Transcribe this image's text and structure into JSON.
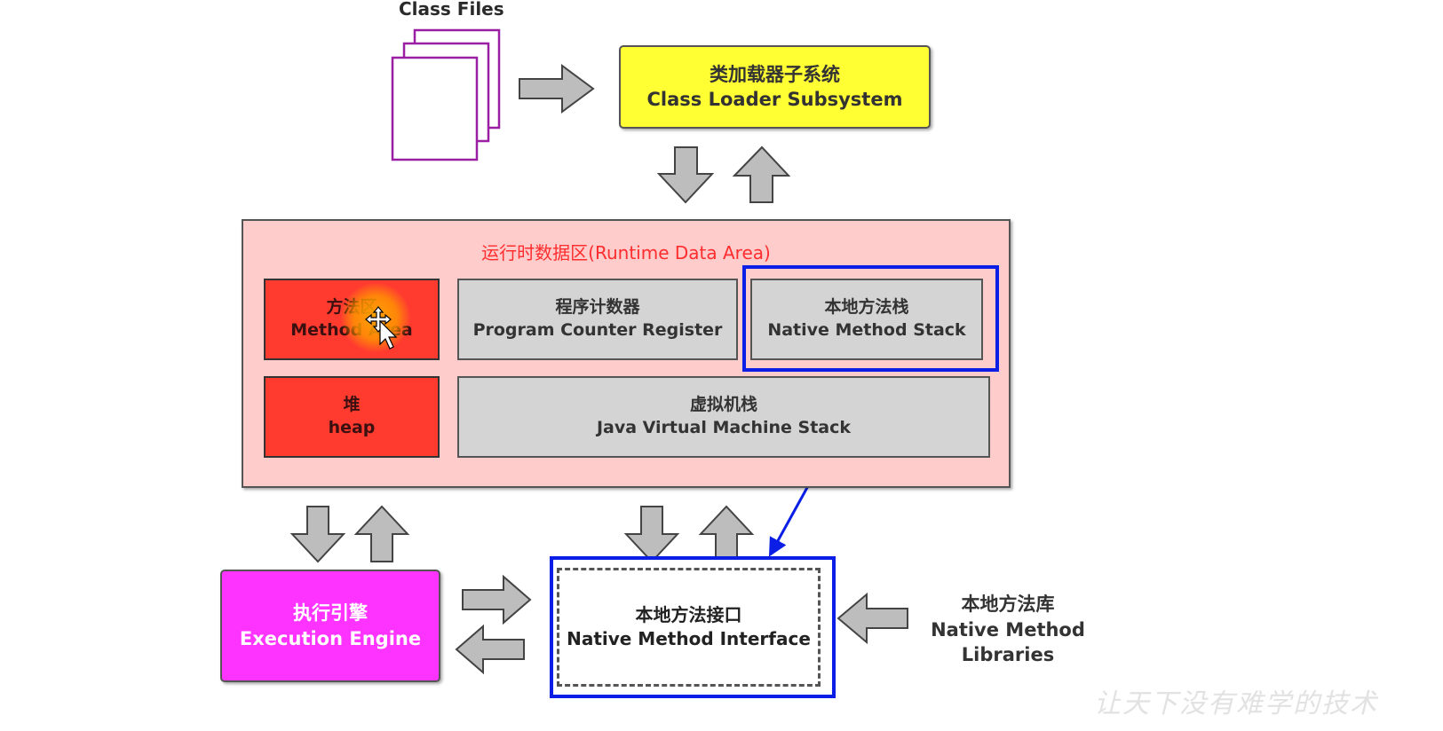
{
  "class_files": {
    "label": "Class Files"
  },
  "class_loader": {
    "line1": "类加载器子系统",
    "line2": "Class Loader Subsystem"
  },
  "runtime_area": {
    "title": "运行时数据区(Runtime Data Area)",
    "method_area": {
      "line1": "方法区",
      "line2": "Method Area"
    },
    "program_counter": {
      "line1": "程序计数器",
      "line2": "Program Counter Register"
    },
    "native_stack": {
      "line1": "本地方法栈",
      "line2": "Native Method Stack"
    },
    "heap": {
      "line1": "堆",
      "line2": "heap"
    },
    "jvm_stack": {
      "line1": "虚拟机栈",
      "line2": "Java Virtual Machine Stack"
    }
  },
  "execution_engine": {
    "line1": "执行引擎",
    "line2": "Execution Engine"
  },
  "native_interface": {
    "line1": "本地方法接口",
    "line2": "Native Method Interface"
  },
  "native_libraries": {
    "line1": "本地方法库",
    "line2": "Native Method",
    "line3": "Libraries"
  },
  "watermark": "让天下没有难学的技术",
  "colors": {
    "class_loader": "#ffff33",
    "runtime_area": "#ffcccc",
    "runtime_title": "#ff2d2d",
    "red_region": "#ff3b30",
    "gray_region": "#d4d4d4",
    "execution_engine": "#ff33ff",
    "highlight_blue": "#0a1ee6",
    "class_file_border": "#9b1fa3",
    "arrow_fill": "#bdbdbd"
  },
  "icons": {
    "cursor": "move-cursor-icon",
    "file_stack": "file-stack-icon"
  }
}
